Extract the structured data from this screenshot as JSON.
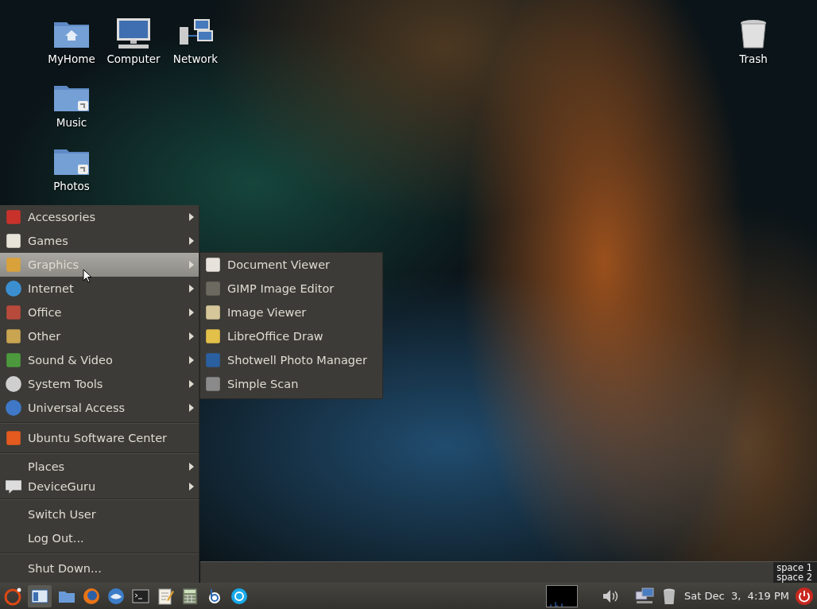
{
  "desktop_icons": [
    {
      "label": "MyHome"
    },
    {
      "label": "Computer"
    },
    {
      "label": "Network"
    },
    {
      "label": "Music"
    },
    {
      "label": "Photos"
    },
    {
      "label": "Trash"
    }
  ],
  "menu": {
    "sections": [
      [
        {
          "label": "Accessories",
          "submenu": true,
          "selected": false
        },
        {
          "label": "Games",
          "submenu": true,
          "selected": false
        },
        {
          "label": "Graphics",
          "submenu": true,
          "selected": true
        },
        {
          "label": "Internet",
          "submenu": true,
          "selected": false
        },
        {
          "label": "Office",
          "submenu": true,
          "selected": false
        },
        {
          "label": "Other",
          "submenu": true,
          "selected": false
        },
        {
          "label": "Sound & Video",
          "submenu": true,
          "selected": false
        },
        {
          "label": "System Tools",
          "submenu": true,
          "selected": false
        },
        {
          "label": "Universal Access",
          "submenu": true,
          "selected": false
        }
      ],
      [
        {
          "label": "Ubuntu Software Center",
          "submenu": false,
          "selected": false
        }
      ],
      [
        {
          "label": "Places",
          "submenu": true,
          "selected": false
        },
        {
          "label": "DeviceGuru",
          "submenu": true,
          "selected": false
        }
      ],
      [
        {
          "label": "Switch User",
          "submenu": false,
          "selected": false
        },
        {
          "label": "Log Out...",
          "submenu": false,
          "selected": false
        }
      ],
      [
        {
          "label": "Shut Down...",
          "submenu": false,
          "selected": false
        }
      ]
    ]
  },
  "submenu": {
    "items": [
      {
        "label": "Document Viewer"
      },
      {
        "label": "GIMP Image Editor"
      },
      {
        "label": "Image Viewer"
      },
      {
        "label": "LibreOffice Draw"
      },
      {
        "label": "Shotwell Photo Manager"
      },
      {
        "label": "Simple Scan"
      }
    ]
  },
  "pager": {
    "workspaces": [
      {
        "label": "space 1"
      },
      {
        "label": "space 2"
      }
    ]
  },
  "taskbar": {
    "clock": "Sat Dec  3,  4:19 PM"
  }
}
